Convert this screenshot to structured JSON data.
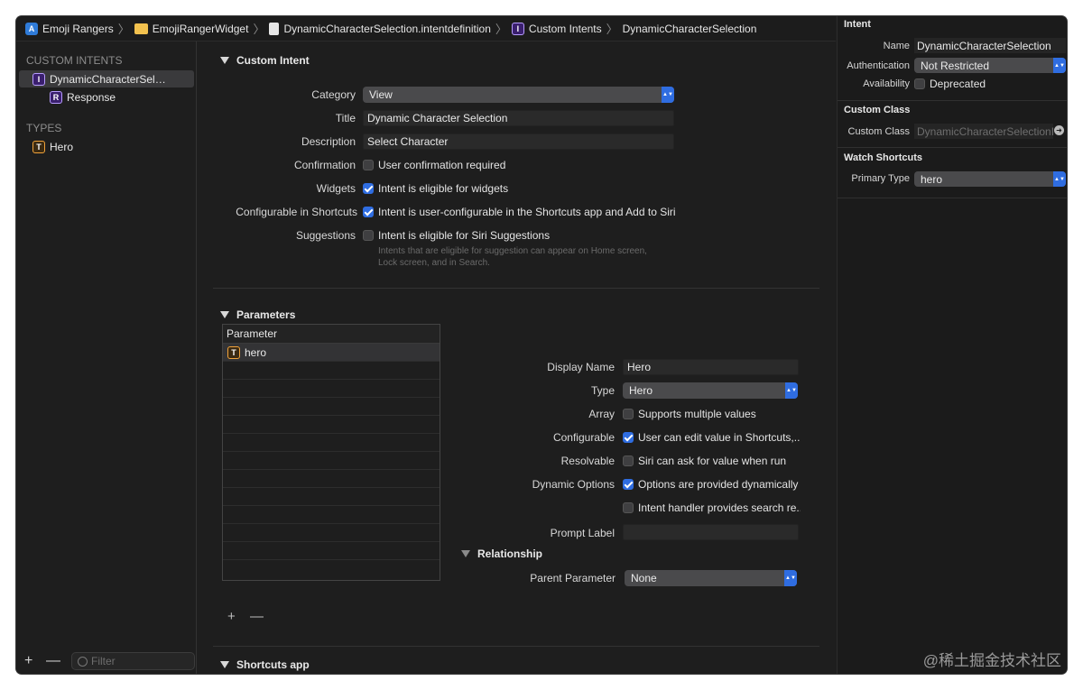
{
  "breadcrumb": {
    "items": [
      "Emoji Rangers",
      "EmojiRangerWidget",
      "DynamicCharacterSelection.intentdefinition",
      "Custom Intents",
      "DynamicCharacterSelection"
    ],
    "sep": "〉"
  },
  "sidebar": {
    "custom_intents_header": "CUSTOM INTENTS",
    "types_header": "TYPES",
    "items": [
      {
        "badge": "I",
        "label": "DynamicCharacterSele..."
      },
      {
        "badge": "R",
        "label": "Response"
      },
      {
        "badge": "T",
        "label": "Hero"
      }
    ],
    "add": "+",
    "remove": "—",
    "filter_placeholder": "Filter"
  },
  "custom_intent": {
    "section_title": "Custom Intent",
    "category_label": "Category",
    "category_value": "View",
    "title_label": "Title",
    "title_value": "Dynamic Character Selection",
    "description_label": "Description",
    "description_value": "Select Character",
    "confirmation_label": "Confirmation",
    "confirmation_text": "User confirmation required",
    "confirmation_checked": false,
    "widgets_label": "Widgets",
    "widgets_text": "Intent is eligible for widgets",
    "widgets_checked": true,
    "configurable_label": "Configurable in Shortcuts",
    "configurable_text": "Intent is user-configurable in the Shortcuts app and Add to Siri",
    "configurable_checked": true,
    "suggestions_label": "Suggestions",
    "suggestions_text": "Intent is eligible for Siri Suggestions",
    "suggestions_checked": false,
    "suggestions_hint_1": "Intents that are eligible for suggestion can appear on Home screen,",
    "suggestions_hint_2": "Lock screen, and in Search."
  },
  "parameters": {
    "section_title": "Parameters",
    "table_header": "Parameter",
    "rows": [
      {
        "badge": "T",
        "label": "hero"
      }
    ],
    "add": "+",
    "remove": "—",
    "display_name_label": "Display Name",
    "display_name_value": "Hero",
    "type_label": "Type",
    "type_value": "Hero",
    "array_label": "Array",
    "array_text": "Supports multiple values",
    "array_checked": false,
    "configurable_label": "Configurable",
    "configurable_text": "User can edit value in Shortcuts,...",
    "configurable_checked": true,
    "resolvable_label": "Resolvable",
    "resolvable_text": "Siri can ask for value when run",
    "resolvable_checked": false,
    "dynamic_options_label": "Dynamic Options",
    "dynamic_options_text": "Options are provided dynamically",
    "dynamic_options_checked": true,
    "search_text": "Intent handler provides search re...",
    "search_checked": false,
    "prompt_label": "Prompt Label",
    "prompt_value": "",
    "relationship_title": "Relationship",
    "parent_parameter_label": "Parent Parameter",
    "parent_parameter_value": "None"
  },
  "shortcuts_app": {
    "section_title": "Shortcuts app"
  },
  "inspector": {
    "intent_header": "Intent",
    "name_label": "Name",
    "name_value": "DynamicCharacterSelection",
    "authentication_label": "Authentication",
    "authentication_value": "Not Restricted",
    "availability_label": "Availability",
    "availability_text": "Deprecated",
    "availability_checked": false,
    "custom_class_header": "Custom Class",
    "custom_class_label": "Custom Class",
    "custom_class_placeholder": "DynamicCharacterSelectionI",
    "watch_shortcuts_header": "Watch Shortcuts",
    "primary_type_label": "Primary Type",
    "primary_type_value": "hero"
  },
  "watermark": "@稀土掘金技术社区"
}
